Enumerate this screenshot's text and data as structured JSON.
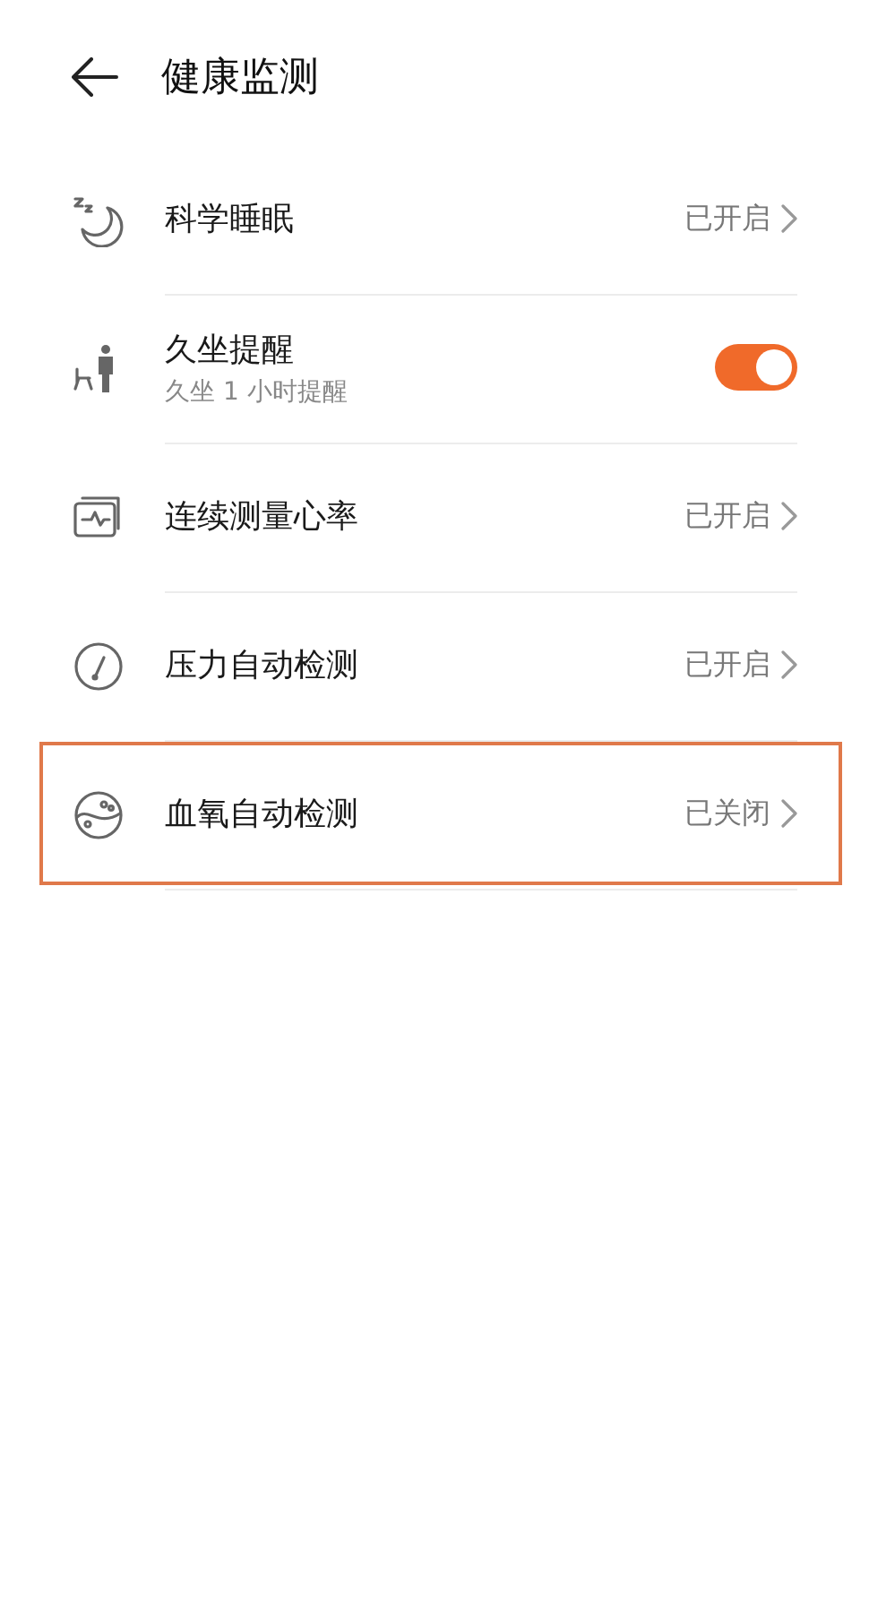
{
  "header": {
    "title": "健康监测"
  },
  "rows": [
    {
      "kind": "link",
      "label": "科学睡眠",
      "status": "已开启",
      "highlighted": false
    },
    {
      "kind": "toggle",
      "label": "久坐提醒",
      "subtitle": "久坐 1 小时提醒",
      "on": true,
      "highlighted": false
    },
    {
      "kind": "link",
      "label": "连续测量心率",
      "status": "已开启",
      "highlighted": false
    },
    {
      "kind": "link",
      "label": "压力自动检测",
      "status": "已开启",
      "highlighted": false
    },
    {
      "kind": "link",
      "label": "血氧自动检测",
      "status": "已关闭",
      "highlighted": true
    }
  ]
}
